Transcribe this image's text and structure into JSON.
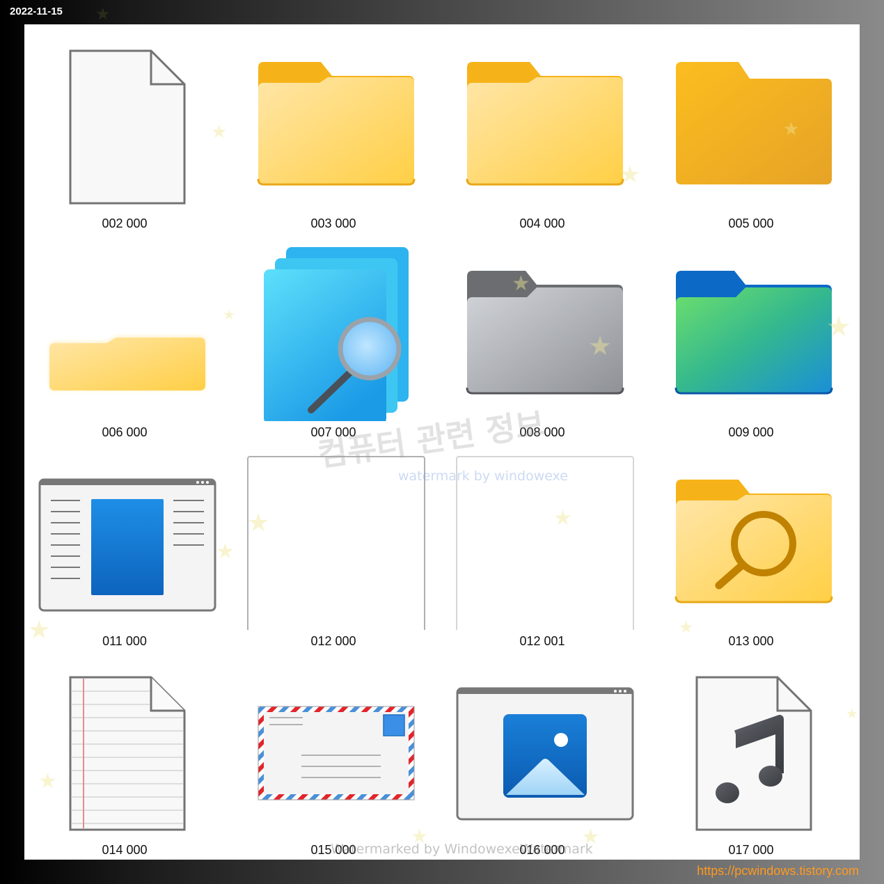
{
  "header": {
    "date": "2022-11-15"
  },
  "footer": {
    "site_url": "https://pcwindows.tistory.com"
  },
  "watermarks": {
    "korean": "컴퓨터 관련 정보",
    "sub": "watermark by windowexe",
    "bottom": "Watermarked by WindowexeWatermark"
  },
  "icons": [
    {
      "label": "002 000",
      "icon": "blank-document-icon"
    },
    {
      "label": "003 000",
      "icon": "folder-icon"
    },
    {
      "label": "004 000",
      "icon": "folder-icon"
    },
    {
      "label": "005 000",
      "icon": "folder-solid-icon"
    },
    {
      "label": "006 000",
      "icon": "folder-flat-icon"
    },
    {
      "label": "007 000",
      "icon": "search-documents-icon"
    },
    {
      "label": "008 000",
      "icon": "folder-gray-icon"
    },
    {
      "label": "009 000",
      "icon": "folder-green-blue-icon"
    },
    {
      "label": "011 000",
      "icon": "document-window-icon"
    },
    {
      "label": "012 000",
      "icon": "empty-frame-icon"
    },
    {
      "label": "012 001",
      "icon": "empty-frame-icon"
    },
    {
      "label": "013 000",
      "icon": "search-folder-icon"
    },
    {
      "label": "014 000",
      "icon": "lined-paper-icon"
    },
    {
      "label": "015 000",
      "icon": "envelope-icon"
    },
    {
      "label": "016 000",
      "icon": "picture-window-icon"
    },
    {
      "label": "017 000",
      "icon": "music-file-icon"
    }
  ],
  "colors": {
    "folder_tab": "#f8b81a",
    "folder_body_light": "#ffe3a0",
    "folder_body_dark": "#ffcc3f",
    "accent_blue": "#0f6fc6"
  }
}
